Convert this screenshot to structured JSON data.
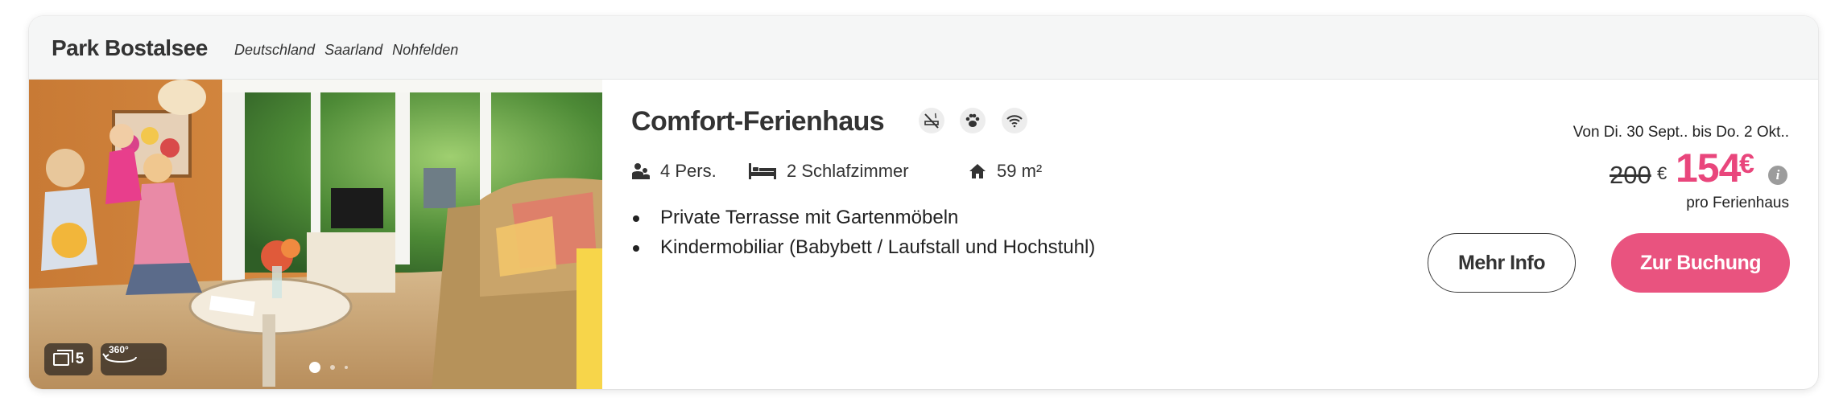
{
  "header": {
    "park_name": "Park Bostalsee",
    "location": [
      "Deutschland",
      "Saarland",
      "Nohfelden"
    ]
  },
  "photo": {
    "count": "5",
    "panorama_label": "360°",
    "carousel_dots": 3,
    "active_dot": 0
  },
  "accommodation": {
    "title": "Comfort-Ferienhaus",
    "amenity_icons": [
      "no-smoking-icon",
      "pets-paw-icon",
      "wifi-icon"
    ],
    "persons": "4 Pers.",
    "bedrooms": "2 Schlafzimmer",
    "area": "59 m²",
    "features": [
      "Private Terrasse mit Gartenmöbeln",
      "Kindermobiliar (Babybett / Laufstall und Hochstuhl)"
    ]
  },
  "pricing": {
    "date_range": "Von Di. 30 Sept.. bis Do. 2 Okt..",
    "old_price": "200",
    "old_currency": "€",
    "new_price": "154",
    "new_currency": "€",
    "info_symbol": "i",
    "per_unit": "pro Ferienhaus",
    "accent_color": "#e9467c"
  },
  "actions": {
    "more_info_label": "Mehr Info",
    "book_label": "Zur Buchung"
  }
}
